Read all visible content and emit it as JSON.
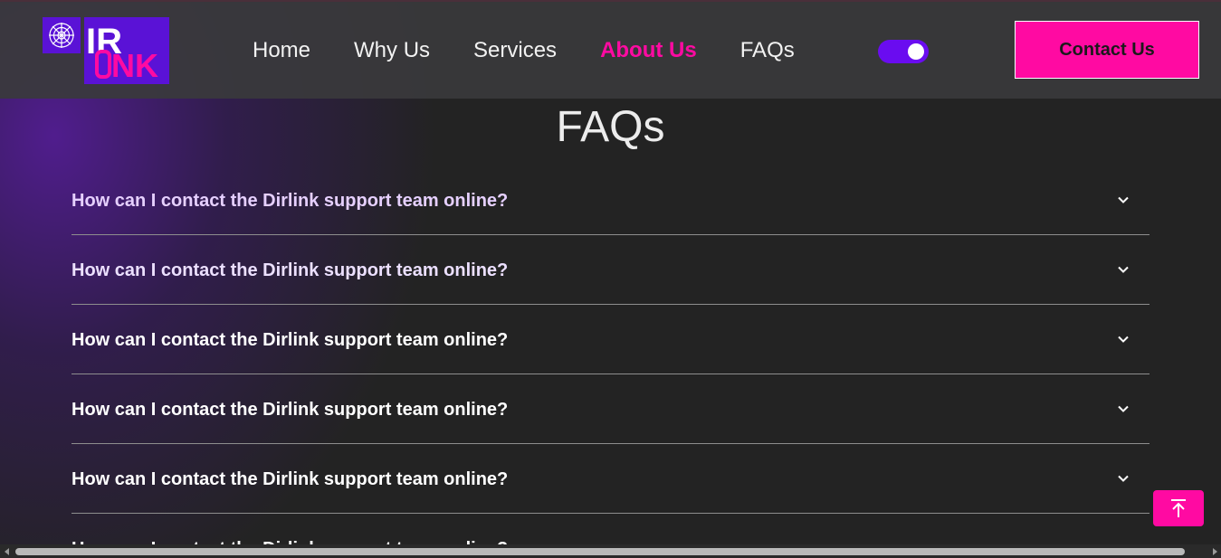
{
  "brand": {
    "logo_text_top": "IR",
    "logo_text_bottom": "NK",
    "logo_icon": "spider-web-icon",
    "colors": {
      "primary": "#6a0cf0",
      "accent": "#ff0aa2"
    }
  },
  "header": {
    "nav": [
      {
        "label": "Home",
        "active": false
      },
      {
        "label": "Why Us",
        "active": false
      },
      {
        "label": "Services",
        "active": false
      },
      {
        "label": "About Us",
        "active": true
      },
      {
        "label": "FAQs",
        "active": false
      }
    ],
    "theme_toggle": {
      "state": "on"
    },
    "contact_label": "Contact Us"
  },
  "main": {
    "title": "FAQs",
    "faqs": [
      {
        "question": "How can I contact the Dirlink support team online?",
        "icon": "chevron-down-icon"
      },
      {
        "question": "How can I contact the Dirlink support team online?",
        "icon": "chevron-down-icon"
      },
      {
        "question": "How can I contact the Dirlink support team online?",
        "icon": "chevron-down-icon"
      },
      {
        "question": "How can I contact the Dirlink support team online?",
        "icon": "chevron-down-icon"
      },
      {
        "question": "How can I contact the Dirlink support team online?",
        "icon": "chevron-down-icon"
      },
      {
        "question": "How can I contact the Dirlink support team online?",
        "icon": "chevron-down-icon"
      }
    ]
  },
  "floating": {
    "back_to_top_icon": "arrow-up-to-top-icon"
  }
}
